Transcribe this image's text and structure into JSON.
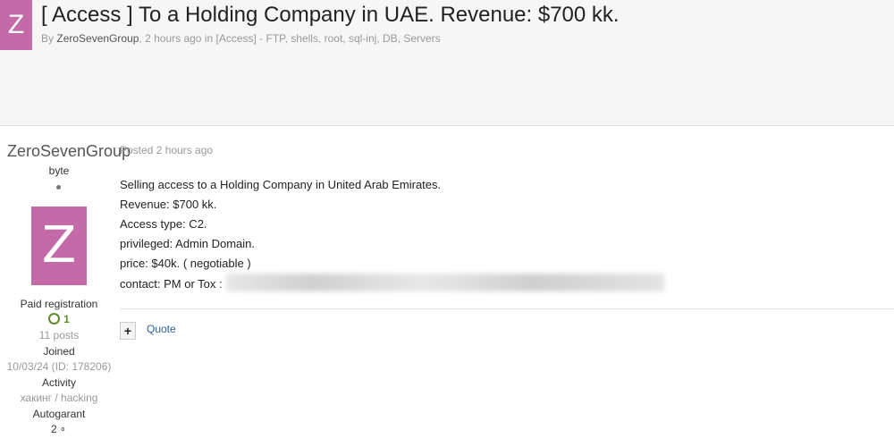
{
  "topic": {
    "avatar_letter": "Z",
    "title": "[ Access ] To a Holding Company in UAE. Revenue: $700 kk.",
    "meta_prefix": "By",
    "author": "ZeroSevenGroup",
    "meta_rest": ", 2 hours ago in [Access] - FTP, shells, root, sql-inj, DB, Servers"
  },
  "author_panel": {
    "name": "ZeroSevenGroup",
    "rank": "byte",
    "avatar_letter": "Z",
    "group": "Paid registration",
    "reputation": "1",
    "posts": "11 posts",
    "joined_label": "Joined",
    "joined_value": "10/03/24 (ID: 178206)",
    "activity_label": "Activity",
    "activity_value": "хакинг / hacking",
    "autogarant_label": "Autogarant",
    "autogarant_value": "2"
  },
  "post": {
    "date": "Posted 2 hours ago",
    "lines": [
      "Selling access to a Holding Company in United Arab Emirates.",
      "Revenue: $700 kk.",
      "Access type: C2.",
      "privileged: Admin Domain.",
      "price: $40k. ( negotiable )",
      "contact: PM or Tox :"
    ],
    "plus_label": "+",
    "quote_label": "Quote"
  },
  "icons": {
    "reputation": "circle-plus-icon",
    "autogarant": "handshake-icon"
  }
}
